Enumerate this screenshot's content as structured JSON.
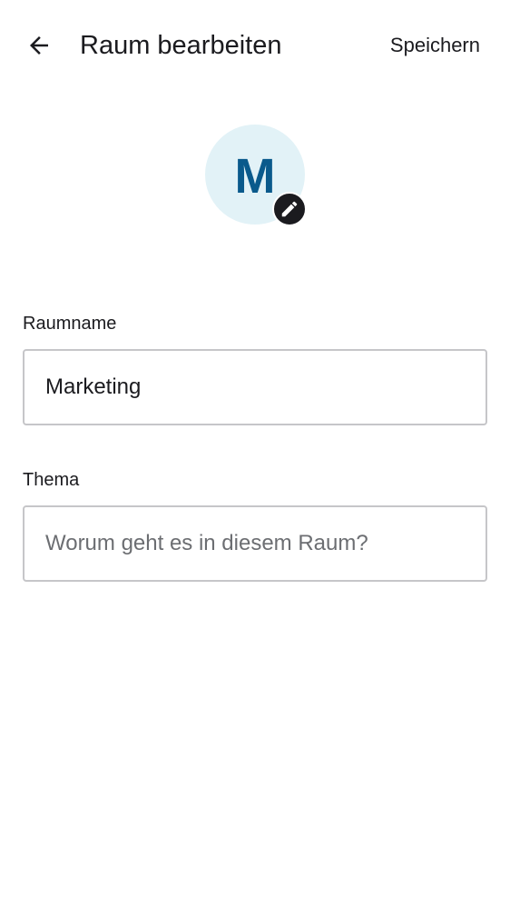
{
  "header": {
    "title": "Raum bearbeiten",
    "save_label": "Speichern"
  },
  "avatar": {
    "letter": "M",
    "background": "#e2f2f7",
    "letter_color": "#0a5a8c",
    "edit_icon": "pencil-icon"
  },
  "form": {
    "room_name": {
      "label": "Raumname",
      "value": "Marketing"
    },
    "topic": {
      "label": "Thema",
      "value": "",
      "placeholder": "Worum geht es in diesem Raum?"
    }
  },
  "icons": {
    "back": "arrow-back-icon",
    "edit": "pencil-icon"
  }
}
